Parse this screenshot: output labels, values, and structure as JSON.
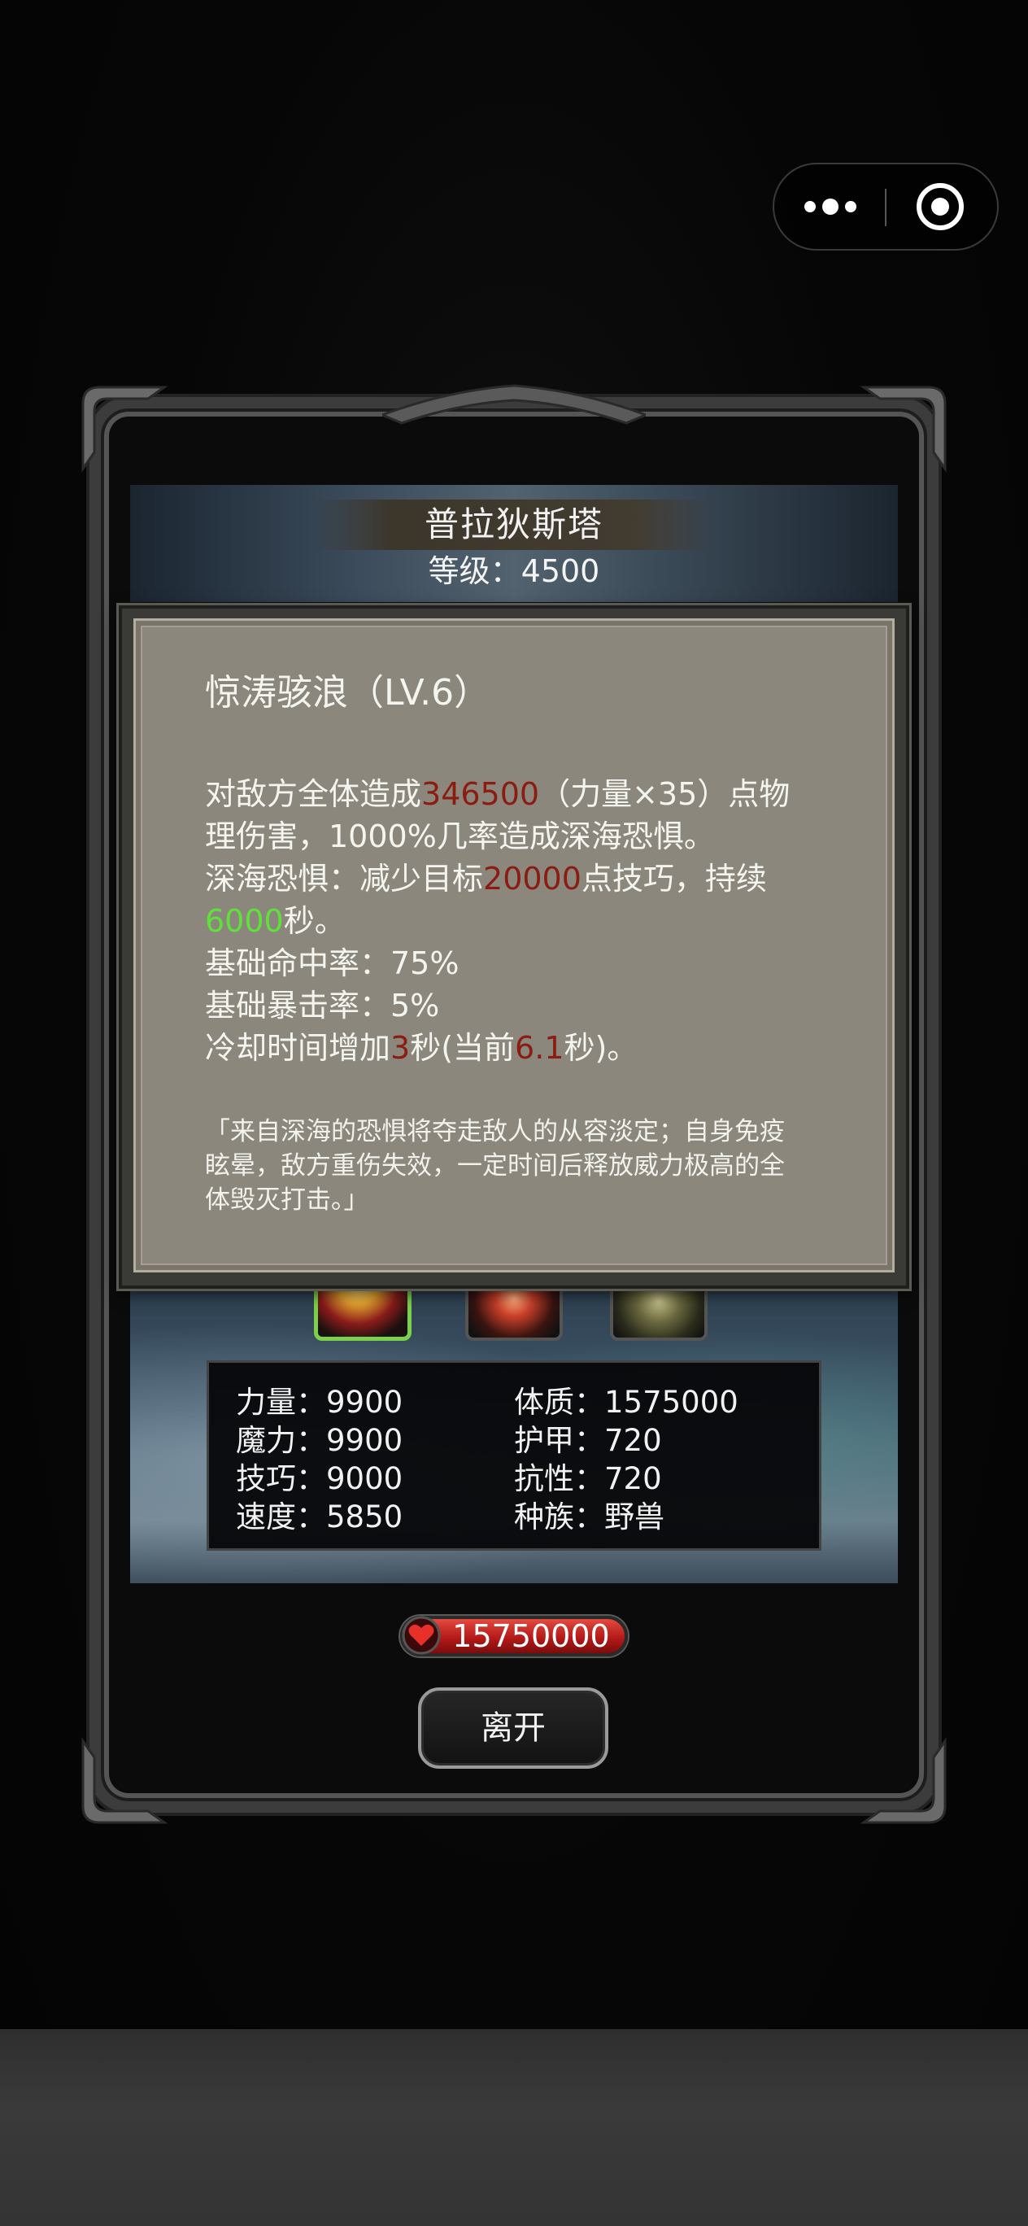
{
  "boss": {
    "name": "普拉狄斯塔",
    "level_text": "等级：4500"
  },
  "skill_popup": {
    "title": "惊涛骇浪（LV.6）",
    "desc": {
      "l1_a": "对敌方全体造成",
      "l1_damage": "346500",
      "l1_b": "（力量×35）点物",
      "l2": "理伤害，1000%几率造成深海恐惧。",
      "l3_a": "深海恐惧：减少目标",
      "l3_value": "20000",
      "l3_b": "点技巧，持续",
      "l4_duration": "6000",
      "l4_b": "秒。",
      "l5": "基础命中率：75%",
      "l6": "基础暴击率：5%",
      "l7_a": "冷却时间增加",
      "l7_add": "3",
      "l7_b": "秒(当前",
      "l7_cur": "6.1",
      "l7_c": "秒)。"
    },
    "quote": [
      "「来自深海的恐惧将夺走敌人的从容淡定；自身免疫",
      "眩晕，敌方重伤失效，一定时间后释放威力极高的全",
      "体毁灭打击。」"
    ]
  },
  "stats": {
    "strength": "力量：9900",
    "magic": "魔力：9900",
    "skill": "技巧：9000",
    "speed": "速度：5850",
    "constitution": "体质：1575000",
    "armor": "护甲：720",
    "resistance": "抗性：720",
    "race": "种族：野兽"
  },
  "hp": {
    "value": "15750000",
    "icon": "heart-icon"
  },
  "leave_button": {
    "label": "离开"
  },
  "capsule": {
    "more_icon": "more-dots-icon",
    "close_icon": "target-circle-icon"
  },
  "colors": {
    "damage_red": "#8a1c12",
    "duration_green": "#60e03a",
    "panel": "#8c877d",
    "hp_red": "#b41a18",
    "selected_skill_border": "#7bd14a"
  }
}
